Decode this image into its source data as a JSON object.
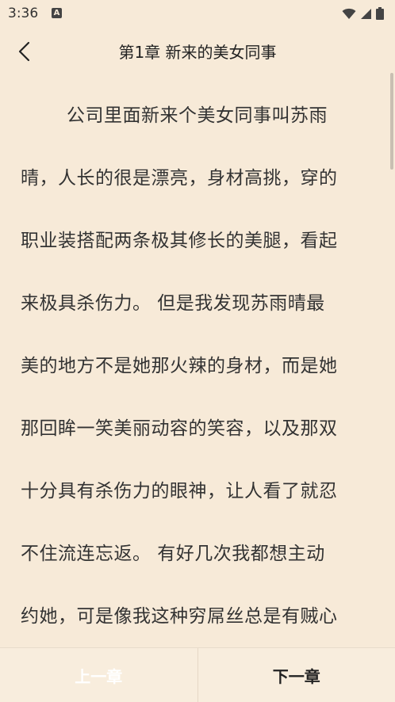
{
  "status_bar": {
    "time": "3:36",
    "notification_glyph": "A",
    "icons": [
      "wifi-icon",
      "cellular-signal-icon",
      "battery-icon"
    ]
  },
  "header": {
    "back_icon": "chevron-left-icon",
    "chapter_title": "第1章 新来的美女同事"
  },
  "content": {
    "lines": [
      "公司里面新来个美女同事叫苏雨",
      "晴，人长的很是漂亮，身材高挑，穿的",
      "职业装搭配两条极其修长的美腿，看起",
      "来极具杀伤力。 但是我发现苏雨晴最",
      "美的地方不是她那火辣的身材，而是她",
      "那回眸一笑美丽动容的笑容，以及那双",
      "十分具有杀伤力的眼神，让人看了就忍",
      "不住流连忘返。 有好几次我都想主动",
      "约她，可是像我这种穷屌丝总是有贼心"
    ]
  },
  "footer": {
    "prev_label": "上一章",
    "next_label": "下一章"
  },
  "colors": {
    "background": "#f7ead8",
    "text": "#333333",
    "disabled": "#ffffff"
  }
}
